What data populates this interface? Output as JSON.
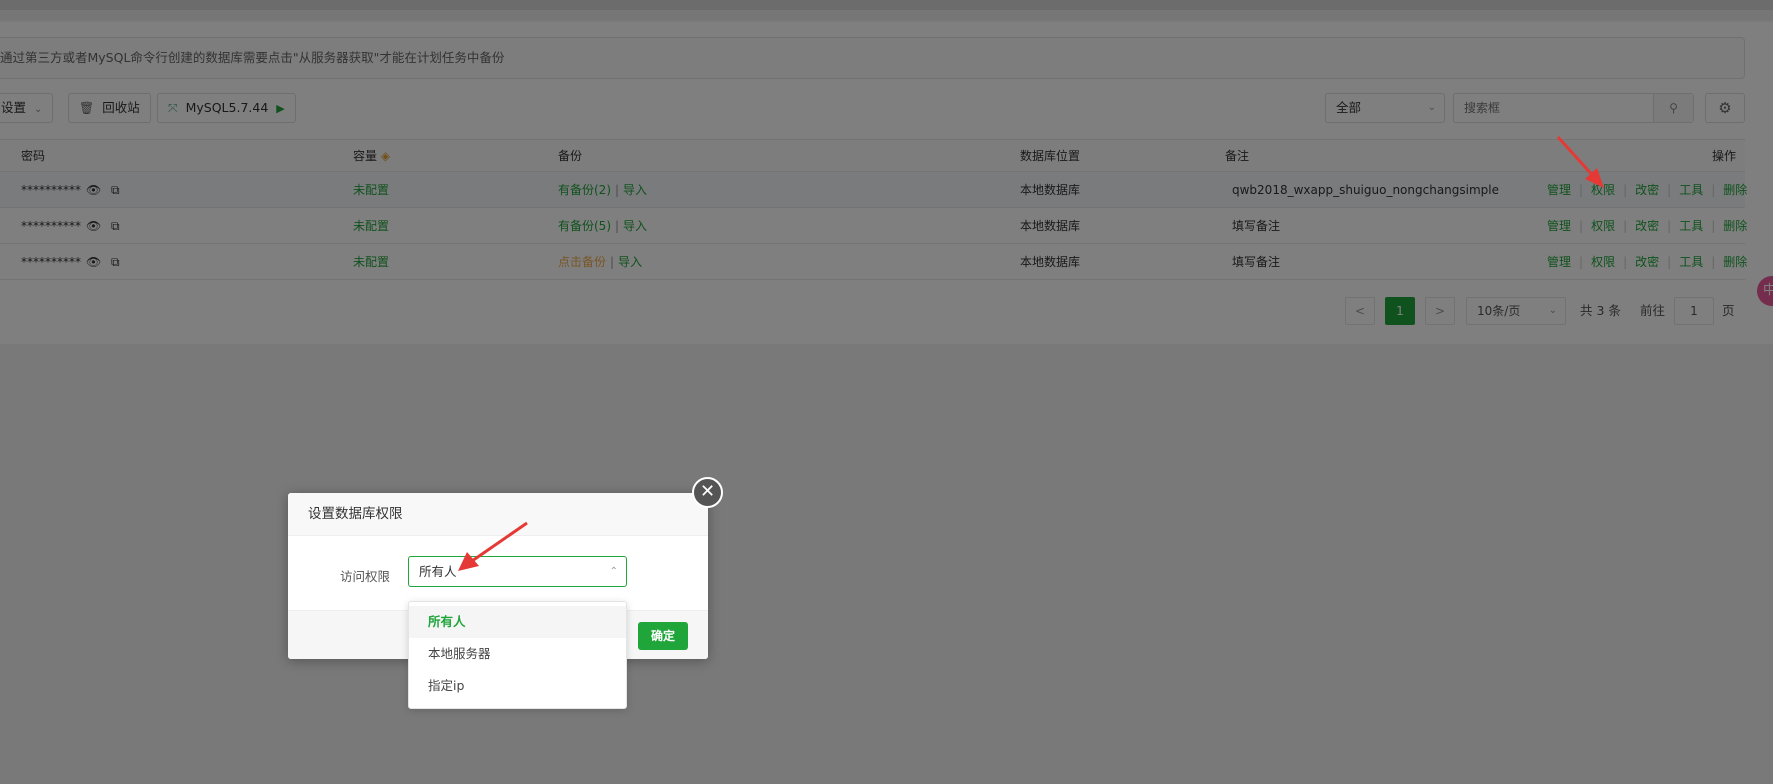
{
  "tip": "通过第三方或者MySQL命令行创建的数据库需要点击\"从服务器获取\"才能在计划任务中备份",
  "toolbar": {
    "settings_label": "设置",
    "recycle_label": "回收站",
    "mysql_label": "MySQL5.7.44",
    "filter_value": "全部",
    "search_placeholder": "搜索框"
  },
  "table": {
    "headers": {
      "password": "密码",
      "capacity": "容量",
      "backup": "备份",
      "location": "数据库位置",
      "remark": "备注",
      "ops": "操作"
    },
    "rows": [
      {
        "password": "**********",
        "capacity": "未配置",
        "backup": "有备份(2)",
        "import": "导入",
        "location": "本地数据库",
        "remark": "qwb2018_wxapp_shuiguo_nongchangsimple"
      },
      {
        "password": "**********",
        "capacity": "未配置",
        "backup": "有备份(5)",
        "import": "导入",
        "location": "本地数据库",
        "remark": "填写备注"
      },
      {
        "password": "**********",
        "capacity": "未配置",
        "backup": "点击备份",
        "import": "导入",
        "location": "本地数据库",
        "remark": "填写备注"
      }
    ],
    "row_separator": "|",
    "ops": {
      "manage": "管理",
      "permission": "权限",
      "change_password": "改密",
      "tools": "工具",
      "delete": "删除"
    }
  },
  "pager": {
    "prev": "<",
    "current": "1",
    "next": ">",
    "per_page": "10条/页",
    "total": "共 3 条",
    "goto_label": "前往",
    "goto_value": "1",
    "page_suffix": "页"
  },
  "side_badge": "中",
  "modal": {
    "title": "设置数据库权限",
    "field_label": "访问权限",
    "selected_value": "所有人",
    "options": [
      "所有人",
      "本地服务器",
      "指定ip"
    ],
    "confirm_label": "确定"
  },
  "colors": {
    "accent": "#20a53a",
    "orange": "#f0ad4e",
    "annotation_arrow": "#e53935"
  }
}
